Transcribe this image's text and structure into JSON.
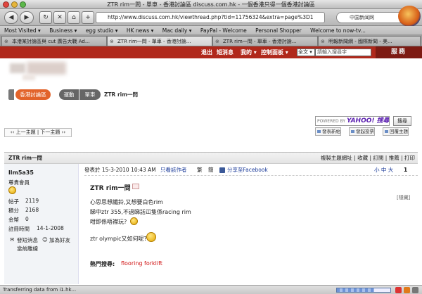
{
  "window": {
    "title": "ZTR rim一問 - 單車 - 香港討論區 discuss.com.hk - 一個香港只得一個香港討論區"
  },
  "toolbar": {
    "url": "http://www.discuss.com.hk/viewthread.php?tid=11756324&extra=page%3D1",
    "search_value": "中国新闻网",
    "back_icon": "back-arrow-icon",
    "forward_icon": "forward-arrow-icon"
  },
  "bookmarks": [
    "Most Visited ▾",
    "Business ▾",
    "egg studio ▾",
    "HK news ▾",
    "Mac daily ▾",
    "PayPal - Welcome",
    "Personal Shopper",
    "Welcome to now-tv..."
  ],
  "tabs": [
    {
      "label": "本港某討論區與 cut 廣告大戰 Ad...",
      "active": false
    },
    {
      "label": "ZTR rim一問 - 單車 - 香港討論...",
      "active": true
    },
    {
      "label": "ZTR rim一問 - 單車 - 香港討論...",
      "active": false
    },
    {
      "label": "明報新聞網 - 國際新聞 - 美...",
      "active": false
    }
  ],
  "site": {
    "nav": {
      "logout": "退出",
      "pm": "短消息",
      "mine": "我的 ▾",
      "control": "控制面板 ▾"
    },
    "lang": "全文 ▾",
    "search_placeholder": "請輸入搜尋字",
    "service": "服務",
    "breadcrumb": [
      "香港討論區",
      "運動",
      "單車",
      "ZTR rim一問"
    ],
    "yahoo_powered": "POWERED BY",
    "yahoo_brand": "YAHOO! 搜尋",
    "search_button": "搜尋",
    "action_buttons": [
      "發表新帖",
      "發起投票",
      "回覆主題"
    ],
    "thread_nav": "‹‹ 上一主題 | 下一主題 ››"
  },
  "post": {
    "header_title": "ZTR rim一問",
    "header_tools": "複製主題網址 | 收藏 | 訂閱 | 推薦 | 打印",
    "author": {
      "name": "llm5a35",
      "rank": "尊貴會員",
      "posts_label": "帖子",
      "posts": "2119",
      "points_label": "積分",
      "points": "2168",
      "coins_label": "金幣",
      "coins": "0",
      "reg_label": "註冊時間",
      "reg": "14-1-2008",
      "send_msg": "發短消息",
      "add_friend": "加為好友",
      "online": "當前離線"
    },
    "meta": {
      "posted": "發表於 15-3-2010 10:43 AM",
      "only_author": "只看該作者",
      "trad": "繁",
      "simp": "簡",
      "share": "分享至Facebook",
      "font_sizes": "小 中 大",
      "floor": "1"
    },
    "subject": "ZTR rim一問",
    "hidden_label": "[隱藏]",
    "lines": [
      "心思思想纖鈴,又想要白色rim",
      "睇中ztr 355,不過睇話冚隻係racing rim",
      "咁即係唔襟玩?",
      "ztr olympic又如何呢?"
    ],
    "hot_label": "熱門搜尋:",
    "hot_link": "flooring forklift"
  },
  "status": {
    "text": "Transferring data from i1.hk...",
    "progress": 0.7
  },
  "colors": {
    "brand_red": "#b0281b",
    "link_blue": "#1a3a99",
    "hot_red": "#d01010"
  }
}
